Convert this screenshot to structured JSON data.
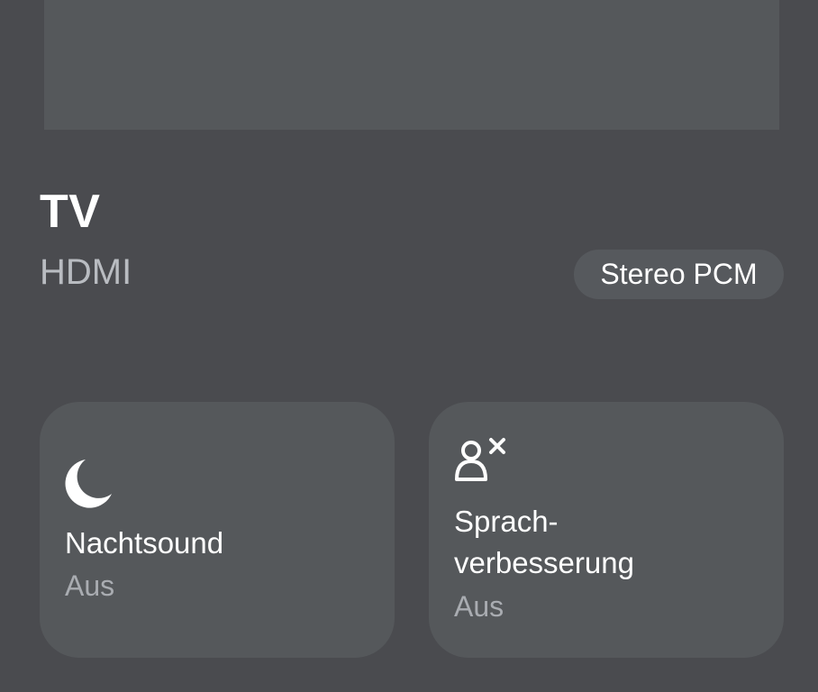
{
  "source": {
    "title": "TV",
    "subtitle": "HDMI",
    "format_badge": "Stereo PCM"
  },
  "tiles": [
    {
      "icon": "moon-icon",
      "label": "Nachtsound",
      "status": "Aus"
    },
    {
      "icon": "person-x-icon",
      "label_line1": "Sprach-",
      "label_line2": "verbesserung",
      "status": "Aus"
    }
  ],
  "colors": {
    "background": "#4a4b4f",
    "tile": "#55585b",
    "secondary_text": "#b9bcc1"
  }
}
